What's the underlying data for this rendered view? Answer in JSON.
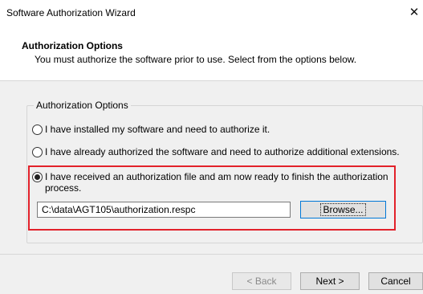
{
  "window": {
    "title": "Software Authorization Wizard",
    "close_glyph": "✕"
  },
  "header": {
    "title": "Authorization Options",
    "subtitle": "You must authorize the software prior to use. Select from the options below."
  },
  "group": {
    "legend": "Authorization Options",
    "options": [
      {
        "label": "I have installed my software and need to authorize it.",
        "selected": false
      },
      {
        "label": "I have already authorized the software and need to authorize additional extensions.",
        "selected": false
      },
      {
        "label": "I have received an authorization file and am now ready to finish the authorization process.",
        "selected": true
      }
    ],
    "file_path": "C:\\data\\AGT105\\authorization.respc",
    "browse_label": "Browse..."
  },
  "footer": {
    "back_label": "< Back",
    "next_label": "Next >",
    "cancel_label": "Cancel"
  },
  "colors": {
    "highlight_border": "#e2212a",
    "focus_border": "#0078d7"
  }
}
